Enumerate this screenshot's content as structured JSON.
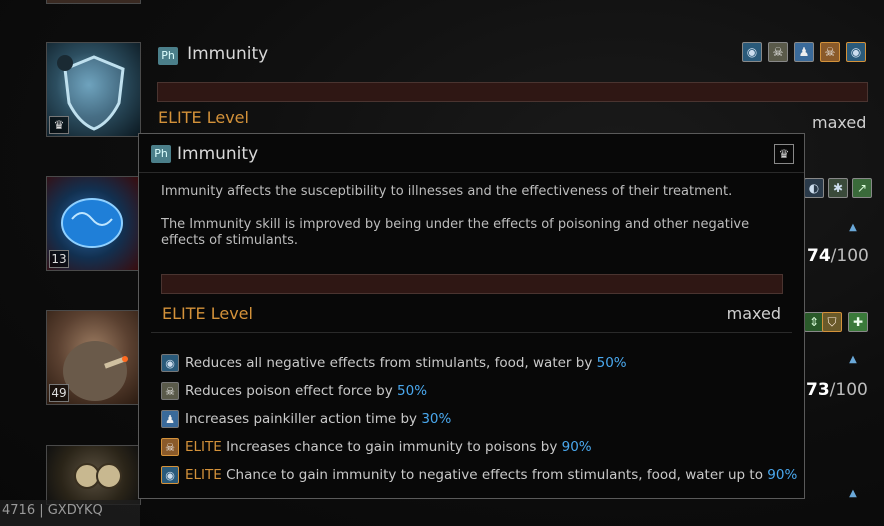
{
  "rows": [
    {
      "level": "13"
    },
    {
      "level": "49"
    }
  ],
  "skill": {
    "badge": "Ph",
    "name": "Immunity",
    "elite_label": "ELITE Level",
    "status": "maxed",
    "effects_icons": [
      "stimulant-icon",
      "skull-icon",
      "person-icon",
      "elite-skull-icon",
      "stimulant-icon"
    ]
  },
  "side_values": [
    {
      "current": "74",
      "sep": "/100"
    },
    {
      "current": "73",
      "sep": "/100"
    }
  ],
  "tooltip": {
    "badge": "Ph",
    "title": "Immunity",
    "desc1": "Immunity affects the susceptibility to illnesses and the effectiveness of their treatment.",
    "desc2": "The Immunity skill is improved by being under the effects of poisoning and other negative effects of stimulants.",
    "elite_label": "ELITE Level",
    "status": "maxed",
    "effects": [
      {
        "icon": "stimulant-icon",
        "elite": "",
        "text": "Reduces all negative effects from stimulants, food, water by ",
        "value": "50%"
      },
      {
        "icon": "skull-icon",
        "elite": "",
        "text": "Reduces poison effect force by ",
        "value": "50%"
      },
      {
        "icon": "person-icon",
        "elite": "",
        "text": "Increases painkiller action time by ",
        "value": "30%"
      },
      {
        "icon": "elite-skull-icon",
        "elite": "ELITE",
        "text": " Increases chance to gain immunity to poisons by ",
        "value": "90%"
      },
      {
        "icon": "stimulant-icon",
        "elite": "ELITE",
        "text": " Chance to gain immunity to negative effects from stimulants, food, water up to ",
        "value": "90%"
      }
    ]
  },
  "footer": {
    "text": "4716 | GXDYKQ"
  },
  "colors": {
    "elite": "#d4923a",
    "value": "#4aa8ee",
    "bar": "#2f1714"
  }
}
